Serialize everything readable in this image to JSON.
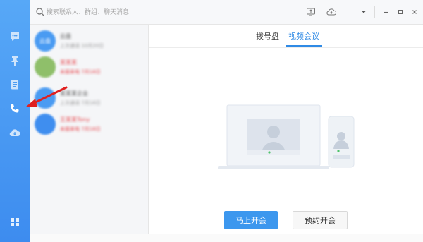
{
  "search": {
    "placeholder": "搜索联系人、群组、聊天消息"
  },
  "sidebar": {
    "items": [
      {
        "icon": "chat-icon"
      },
      {
        "icon": "pin-icon"
      },
      {
        "icon": "contacts-book-icon"
      },
      {
        "icon": "phone-icon"
      },
      {
        "icon": "cloud-drive-icon"
      },
      {
        "icon": "apps-grid-icon"
      }
    ]
  },
  "toolbar": {
    "icons": [
      "screen-share-icon",
      "cloud-upload-icon",
      "dropdown-caret-icon",
      "minimize-icon",
      "maximize-icon",
      "close-icon"
    ]
  },
  "contacts": [
    {
      "avatar": "云盘",
      "name": "云盘",
      "sub": "上次通话 10月20日",
      "avatar_color": "#4a9bf2",
      "highlight": false
    },
    {
      "avatar": "",
      "name": "某某某",
      "sub": "未接来电 7月18日",
      "avatar_color": "#8fbf6a",
      "highlight": true
    },
    {
      "avatar": "",
      "name": "某某某企业",
      "sub": "上次通话 7月18日",
      "avatar_color": "#4a9bf2",
      "highlight": false
    },
    {
      "avatar": "",
      "name": "王某某Tony",
      "sub": "未接来电 7月18日",
      "avatar_color": "#3f8eef",
      "highlight": true
    }
  ],
  "main": {
    "tabs": [
      {
        "label": "拨号盘",
        "active": false
      },
      {
        "label": "视频会议",
        "active": true
      }
    ],
    "start_meeting_label": "马上开会",
    "schedule_meeting_label": "预约开会"
  },
  "colors": {
    "accent": "#2f8ae5",
    "rail": "#4a9bf2",
    "missed": "#e8474d"
  }
}
